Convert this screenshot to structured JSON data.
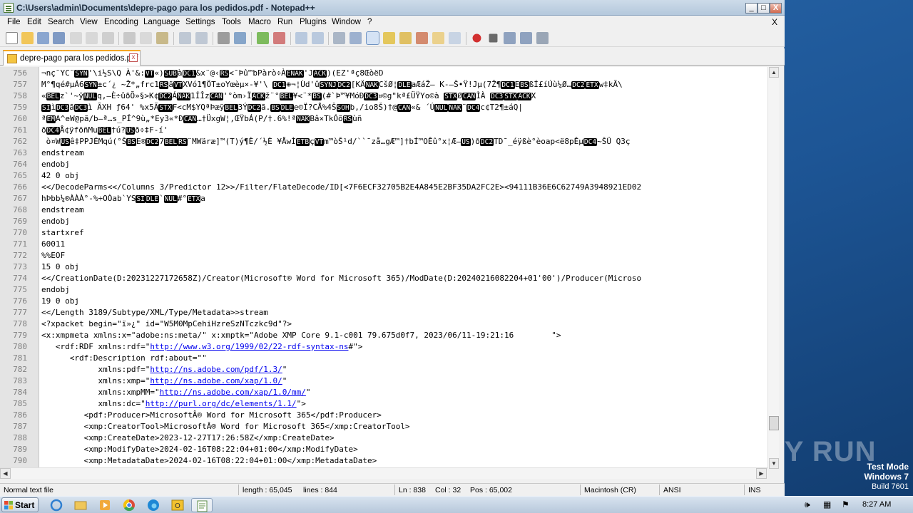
{
  "window": {
    "title": "C:\\Users\\admin\\Documents\\depre-pago para los pedidos.pdf - Notepad++",
    "min": "_",
    "max": "□",
    "close": "X"
  },
  "menu": {
    "items": [
      "File",
      "Edit",
      "Search",
      "View",
      "Encoding",
      "Language",
      "Settings",
      "Tools",
      "Macro",
      "Run",
      "Plugins",
      "Window",
      "?"
    ],
    "close": "X"
  },
  "tab": {
    "label": "depre-pago para los pedidos.pdf",
    "close": "x"
  },
  "lines": [
    {
      "n": "756",
      "t": "¬nç¨YC¨<b>SYN</b>'\\i½S\\Q À'&:<b>VT</b>«)<b>SUB</b>à<b>DC1</b>&x¨@‹<b>RS</b><¯Þû™bPàrò÷À<b>ENAK</b>'J<b>ACK</b>)(EZ'ªç8ŒòëD"
    },
    {
      "n": "757",
      "t": "M°¶qé#µÁ6<b>SYN</b>±c´¿ ~Ž*„frc1<b>RS</b>ã<b>VT</b>XVó1¶ÖT±oYœèµ×-¥'\\ <b>DC1</b>⊕¬¦Ùd'û<b>SYNJ</b><b>DC2</b>[KÄ<b>NAK</b>CšØ¦<b>DLE</b>aÆáŽ– K-–Š•Ÿ!Jµ(7Ž¶<b>DC1</b>E<b>BS</b>ßÍ£íÚù¼Ø…<b>DC2</b><b>ETX</b>w‡kÃ\\"
    },
    {
      "n": "758",
      "t": "«<b>BEL</b>z`'~ÿ<b>NUL</b>q,–È÷ûðÕ»§>K¢<b>DC2</b>Á<b>NAK</b>1ÍÎz<b>CAN</b>'°òm›Ï<b>ACK</b>ž¨°<b>BEL</b>¥<¨*<b>BS</b>(#`Þ™¥MóÐ<b>DC3</b>¤©g\"kª£ÜŸYo©à <b>STX</b>Ø<b>CAN</b>ÌÀ <b>DC3</b><b>STX</b><b>ACK</b>X"
    },
    {
      "n": "759",
      "t": "<b>SI</b>ì<b>DC3</b>ã<b>DC3</b>ì ÃXH ƒ64' %x5Ã<b>STX</b>F<cM$YQªÞæÿ<b>BEL</b>3Ý<b>DC2</b>ã.<b>BS</b><b>DLE</b>e©Ï?CÅ%4Š<b>SOH</b>b,/io8Š)†@<b>CAN</b>«& ´Ú<b>NUL</b><b>NAK</b>¨<b>DC4</b>c¢T2¶±áQ|"
    },
    {
      "n": "760",
      "t": "ª<b>EM</b>A^eW@pã/b–ª…s_PÍ^9ù„*Ey3«*Ð<b>CAN</b>…†ÜxgW¦‚ŒŸbÁ(P/†.6%!ª<b>NAK</b>Bâ×TkÓõ<b>RS</b>ùñ"
    },
    {
      "n": "761",
      "t": "ð<b>DC4</b>Å¢ÿföñMu<b>BEL</b>†ú?<b>US</b>ð÷‡F-í'"
    },
    {
      "n": "762",
      "t": " ò¤W<b>US</b>ê‡PPJÉMqú(°Š<b>BS</b>E®<b>DC2</b>7<b>BEL</b><b>RS</b>¨MWäræ]™(T)ý¶È/´½È ¥ÅwÌ<b>ETB</b>ç<b>VT</b>m™òŠ¹d/``¯zå…gÆ™]†bÍ™OÊû°x¦Æ–<b>US</b>)ð<b>DC2</b>TD¯_éÿßè°èoap<ë8pÊµ<b>DC4</b>~ŠÜ Q3ç"
    },
    {
      "n": "763",
      "t": "endstream"
    },
    {
      "n": "764",
      "t": "endobj"
    },
    {
      "n": "765",
      "t": "42 0 obj"
    },
    {
      "n": "766",
      "t": "<<<i>/DecodeParms<</Columns 3/Predictor 12>>/Filter/FlateDecode/ID[<7F6ECF32705B2E4A845E2BF35DA2FC2E><94111B36E6C62749A3948921ED02"
    },
    {
      "n": "767",
      "t": "hÞbb¼®ÀÀÀ°-%÷OÒab`YS<b>SI</b><b>DLE</b>`<b>NUL</b>#°<b>ETX</b>a"
    },
    {
      "n": "768",
      "t": "endstream"
    },
    {
      "n": "769",
      "t": "endobj"
    },
    {
      "n": "770",
      "t": "startxref"
    },
    {
      "n": "771",
      "t": "60011"
    },
    {
      "n": "772",
      "t": "%%EOF"
    },
    {
      "n": "773",
      "t": "15 0 obj"
    },
    {
      "n": "774",
      "t": "<</CreationDate(D:20231227172658Z)/Creator(Microsoft® Word for Microsoft 365)/ModDate(D:20240216082204+01'00')/Producer(Microso"
    },
    {
      "n": "775",
      "t": "endobj"
    },
    {
      "n": "776",
      "t": "19 0 obj"
    },
    {
      "n": "777",
      "t": "<</Length 3189/Subtype/XML/Type/Metadata>>stream"
    },
    {
      "n": "778",
      "t": "<?xpacket begin=\"ï»¿\" id=\"W5M0MpCehiHzreSzNTczkc9d\"?>"
    },
    {
      "n": "779",
      "t": "<x:xmpmeta xmlns:x=\"adobe:ns:meta/\" x:xmptk=\"Adobe XMP Core 9.1-c001 79.675d0f7, 2023/06/11-19:21:16        \">"
    },
    {
      "n": "780",
      "t": "   <rdf:RDF xmlns:rdf=\"<a>http://www.w3.org/1999/02/22-rdf-syntax-ns</a>#\">"
    },
    {
      "n": "781",
      "t": "      <rdf:Description rdf:about=\"\""
    },
    {
      "n": "782",
      "t": "            xmlns:pdf=\"<a>http://ns.adobe.com/pdf/1.3/</a>\""
    },
    {
      "n": "783",
      "t": "            xmlns:xmp=\"<a>http://ns.adobe.com/xap/1.0/</a>\""
    },
    {
      "n": "784",
      "t": "            xmlns:xmpMM=\"<a>http://ns.adobe.com/xap/1.0/mm/</a>\""
    },
    {
      "n": "785",
      "t": "            xmlns:dc=\"<a>http://purl.org/dc/elements/1.1/</a>\">"
    },
    {
      "n": "786",
      "t": "         <pdf:Producer>MicrosoftÂ® Word for Microsoft 365</pdf:Producer>"
    },
    {
      "n": "787",
      "t": "         <xmp:CreatorTool>MicrosoftÂ® Word for Microsoft 365</xmp:CreatorTool>"
    },
    {
      "n": "788",
      "t": "         <xmp:CreateDate>2023-12-27T17:26:58Z</xmp:CreateDate>"
    },
    {
      "n": "789",
      "t": "         <xmp:ModifyDate>2024-02-16T08:22:04+01:00</xmp:ModifyDate>"
    },
    {
      "n": "790",
      "t": "         <xmp:MetadataDate>2024-02-16T08:22:04+01:00</xmp:MetadataDate>"
    }
  ],
  "status": {
    "file_type": "Normal text file",
    "length": "length : 65,045",
    "lines": "lines : 844",
    "ln": "Ln : 838",
    "col": "Col : 32",
    "pos": "Pos : 65,002",
    "eol": "Macintosh (CR)",
    "encoding": "ANSI",
    "ins": "INS"
  },
  "desktop": {
    "watermark": "ANY RUN",
    "test_mode": "Test Mode",
    "os": "Windows 7",
    "build": "Build 7601"
  },
  "taskbar": {
    "start": "Start",
    "clock": "8:27 AM"
  }
}
